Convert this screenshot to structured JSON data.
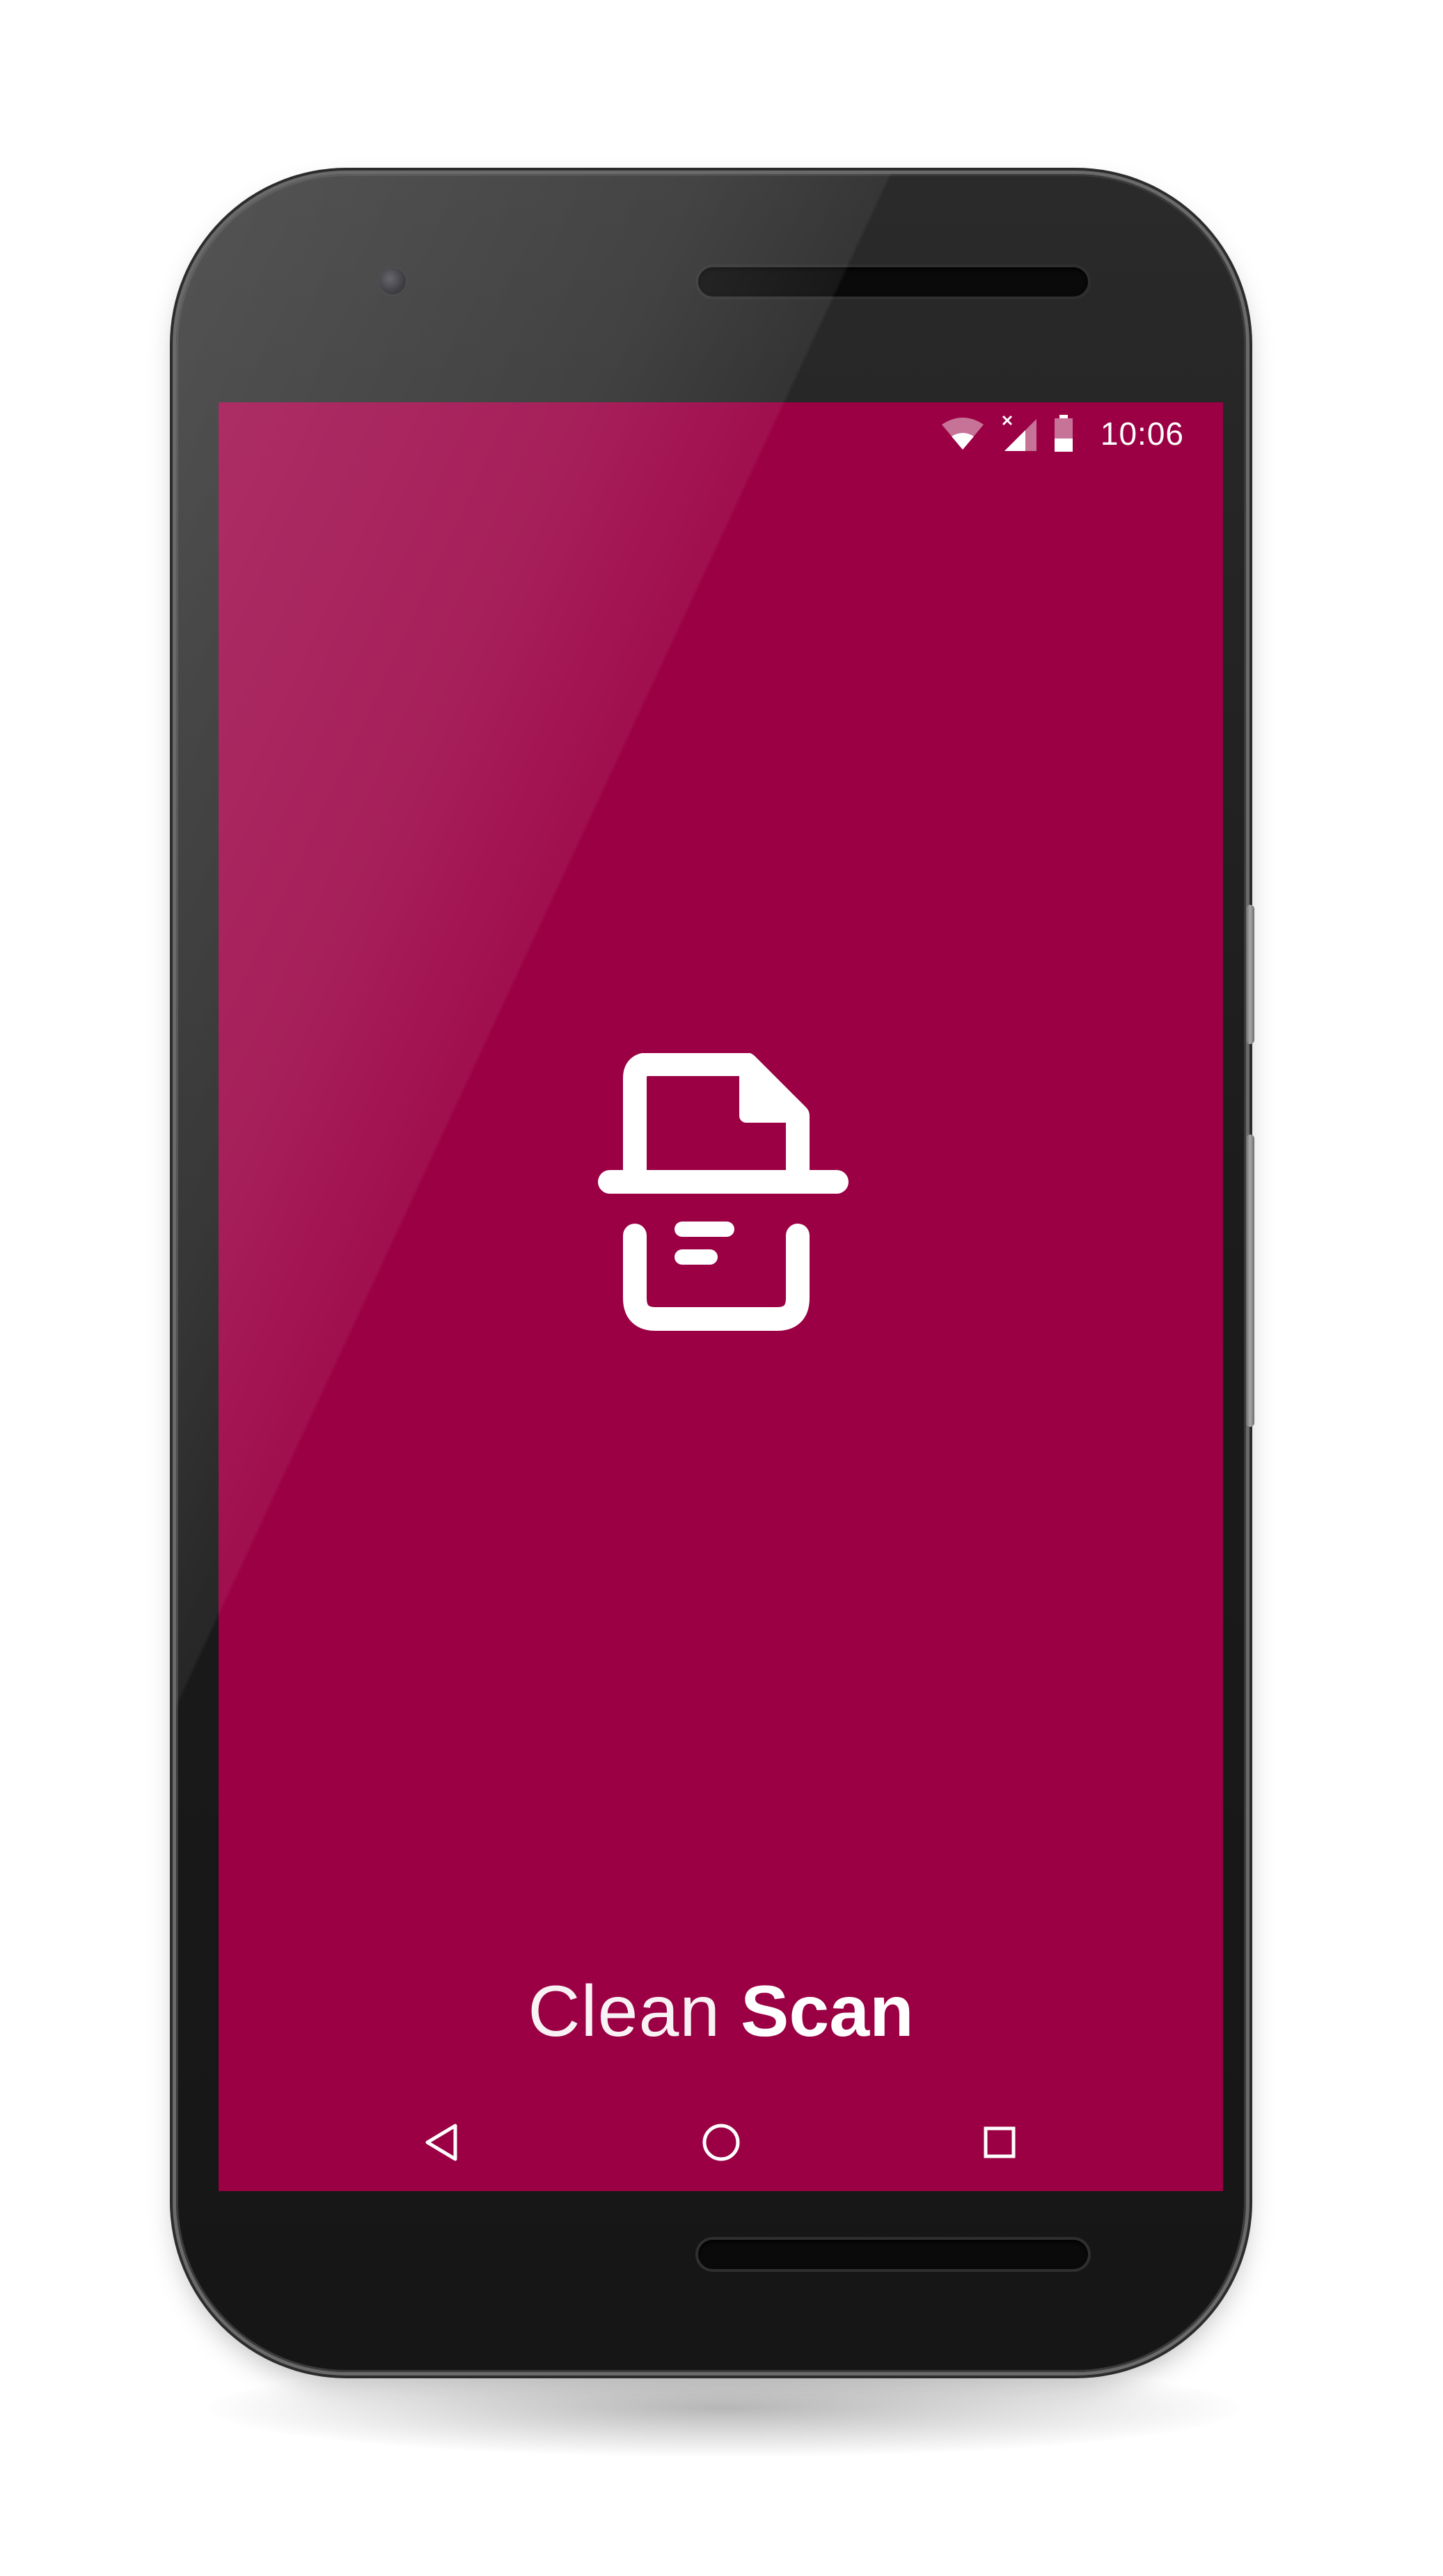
{
  "status_bar": {
    "time": "10:06",
    "wifi_icon": "wifi-icon",
    "signal_icon": "cell-signal-no-data-icon",
    "battery_icon": "battery-icon"
  },
  "app": {
    "logo_icon": "document-scanner-icon",
    "brand_light": "Clean",
    "brand_bold": "Scan"
  },
  "nav_bar": {
    "back_icon": "back-triangle-icon",
    "home_icon": "home-circle-icon",
    "recents_icon": "recents-square-icon"
  },
  "colors": {
    "screen_background": "#9a0043",
    "foreground": "#ffffff",
    "device_body": "#1b1b1b"
  }
}
